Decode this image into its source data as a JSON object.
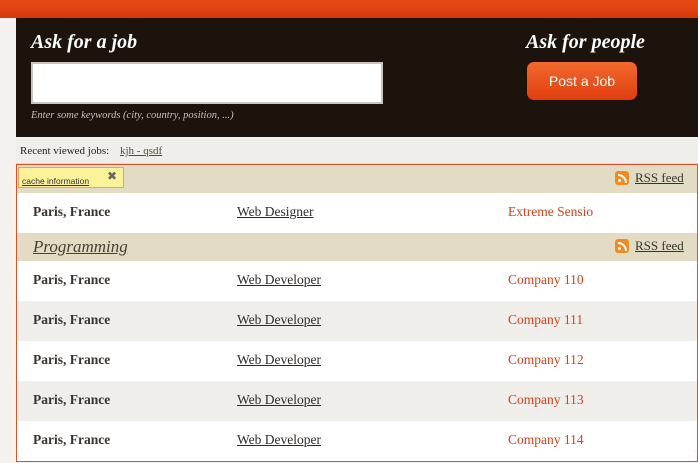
{
  "header": {
    "ask_job_title": "Ask for a job",
    "ask_people_title": "Ask for people",
    "search_value": "",
    "search_hint": "Enter some keywords (city, country, position, ...)",
    "post_job_label": "Post a Job"
  },
  "recent": {
    "label": "Recent viewed jobs:",
    "link": "kjh - qsdf"
  },
  "cache": {
    "label": "cache information",
    "close_glyph": "✖"
  },
  "rss_label": "RSS feed",
  "first_section": {
    "rows": [
      {
        "location": "Paris, France",
        "title": "Web Designer",
        "company": "Extreme Sensio"
      }
    ]
  },
  "programming": {
    "title": "Programming",
    "rows": [
      {
        "location": "Paris, France",
        "title": "Web Developer",
        "company": "Company 110"
      },
      {
        "location": "Paris, France",
        "title": "Web Developer",
        "company": "Company 111"
      },
      {
        "location": "Paris, France",
        "title": "Web Developer",
        "company": "Company 112"
      },
      {
        "location": "Paris, France",
        "title": "Web Developer",
        "company": "Company 113"
      },
      {
        "location": "Paris, France",
        "title": "Web Developer",
        "company": "Company 114"
      }
    ]
  },
  "colors": {
    "accent": "#e03d0e",
    "header_bg": "#1c130c",
    "section_bg": "#e2dcc5",
    "company_text": "#d4411c"
  }
}
